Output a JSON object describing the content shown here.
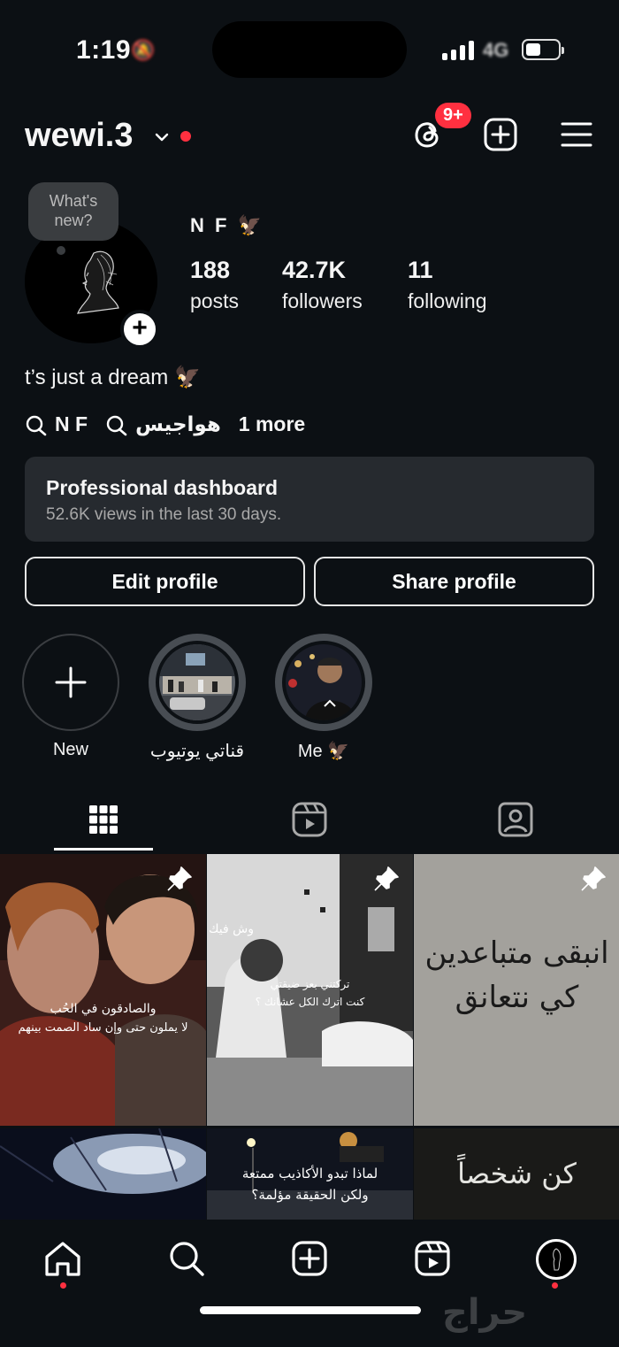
{
  "status_bar": {
    "time": "1:19",
    "network": "4G",
    "bell_icon": "bell-icon"
  },
  "header": {
    "username": "wewi.3",
    "threads_badge": "9+"
  },
  "profile": {
    "bubble": "What's new?",
    "bubble_line1": "What's",
    "bubble_line2": "new?",
    "name": "N F 🦅",
    "stats": [
      {
        "value": "188",
        "label": "posts"
      },
      {
        "value": "42.7K",
        "label": "followers"
      },
      {
        "value": "11",
        "label": "following"
      }
    ],
    "bio": "t’s just a dream 🦅",
    "links": [
      {
        "label": "N F"
      },
      {
        "label": "هواجيس"
      }
    ],
    "more_links": "1 more"
  },
  "dashboard": {
    "title": "Professional dashboard",
    "subtitle": "52.6K views in the last 30 days."
  },
  "buttons": {
    "edit": "Edit profile",
    "share": "Share profile"
  },
  "highlights": [
    {
      "label": "New"
    },
    {
      "label": "قناتي يوتيوب"
    },
    {
      "label": "Me 🦅"
    }
  ],
  "grid_captions": {
    "post1_line1": "والصادقون في الحُب",
    "post1_line2": "لا يملون حتى وإن ساد الصمت بينهم",
    "post2_top": "وش فيك",
    "post2_line1": "تركتني بعز ضيقتي",
    "post2_line2": "كنت اترك الكل عشانك ؟",
    "post3_line1": "انبقى متباعدين",
    "post3_line2": "كي نتعانق",
    "post5_line1": "لماذا تبدو الأكاذيب ممتعة",
    "post5_line2": "ولكن الحقيقة مؤلمة؟",
    "post6_line1": "كن شخصاً"
  },
  "watermark": "حراج",
  "colors": {
    "background": "#0c1014",
    "accent_red": "#ff3040",
    "card": "#262a2f"
  }
}
